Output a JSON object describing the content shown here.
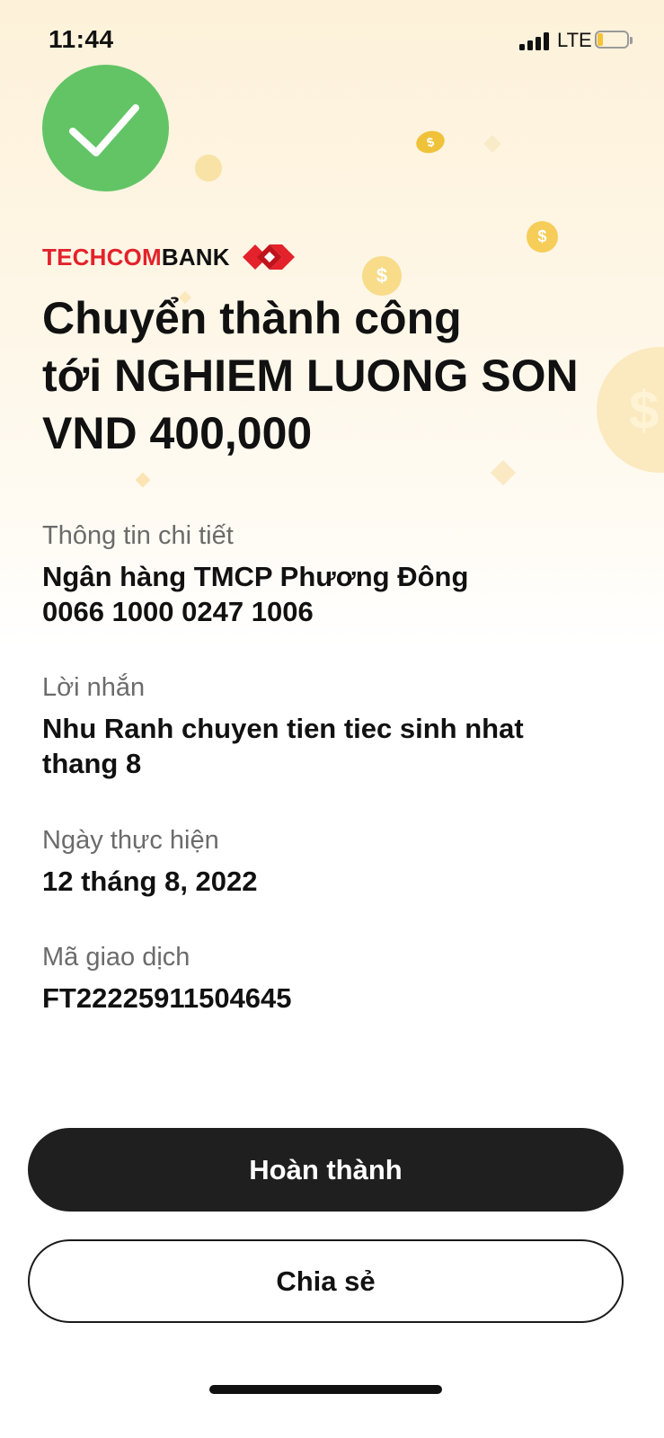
{
  "status_bar": {
    "time": "11:44",
    "network": "LTE",
    "battery_level": 0.2,
    "signal_bars": 4
  },
  "status_icon": "check-circle-icon",
  "brand": {
    "logo_text_red": "TECHCOM",
    "logo_text_black": "BANK",
    "brand_red": "#e3222b",
    "mark_icon": "techcombank-diamond-icon"
  },
  "title": {
    "line1": "Chuyển thành công",
    "line2": "tới NGHIEM LUONG SON",
    "line3": "VND 400,000"
  },
  "details": {
    "info": {
      "label": "Thông tin chi tiết",
      "bank": "Ngân hàng TMCP Phương Đông",
      "account": "0066 1000 0247 1006"
    },
    "message": {
      "label": "Lời nhắn",
      "line1": "Nhu Ranh chuyen tien tiec sinh nhat",
      "line2": "thang 8"
    },
    "date": {
      "label": "Ngày thực hiện",
      "value": "12 tháng 8, 2022"
    },
    "transaction": {
      "label": "Mã giao dịch",
      "value": "FT22225911504645"
    }
  },
  "actions": {
    "done_label": "Hoàn thành",
    "share_label": "Chia sẻ"
  },
  "colors": {
    "success_green": "#63c466",
    "primary_button": "#1f1f1f",
    "coin_gold": "#f3c43a",
    "background_top": "#fdf1d9"
  }
}
